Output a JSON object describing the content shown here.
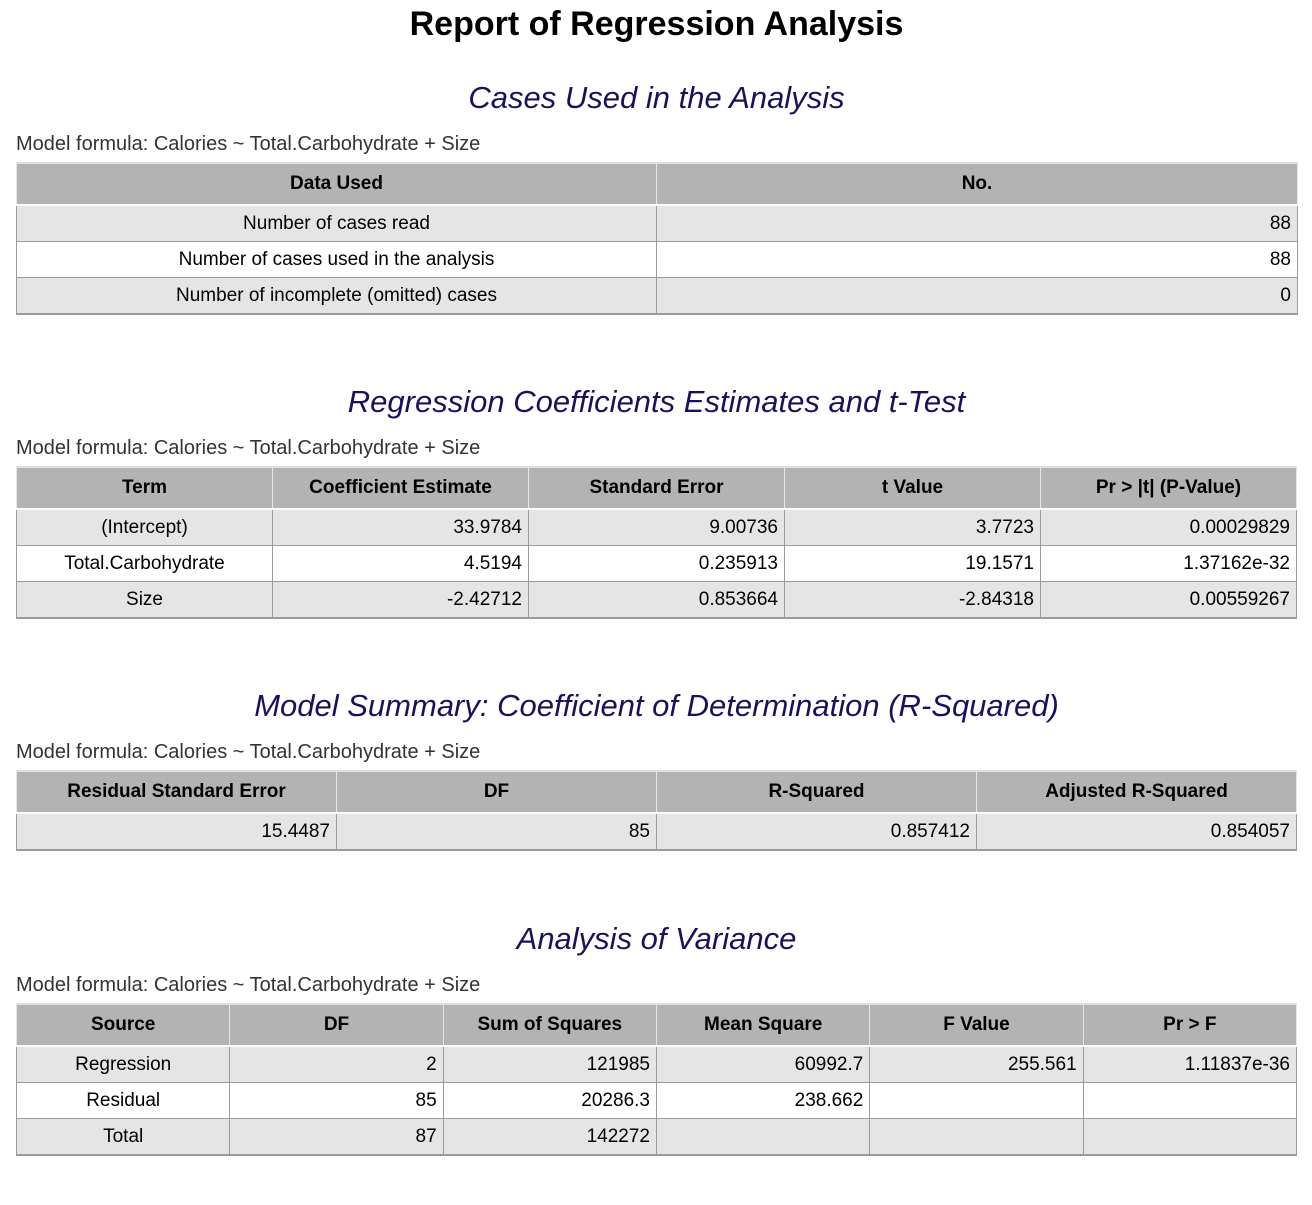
{
  "report_title": "Report of Regression Analysis",
  "sections": {
    "cases": {
      "title": "Cases Used in the Analysis",
      "formula": "Model formula: Calories ~ Total.Carbohydrate + Size",
      "headers": [
        "Data Used",
        "No."
      ],
      "rows": [
        [
          "Number of cases read",
          "88"
        ],
        [
          "Number of cases used in the analysis",
          "88"
        ],
        [
          "Number of incomplete (omitted) cases",
          "0"
        ]
      ]
    },
    "coef": {
      "title": "Regression Coefficients Estimates and t-Test",
      "formula": "Model formula: Calories ~ Total.Carbohydrate + Size",
      "headers": [
        "Term",
        "Coefficient Estimate",
        "Standard Error",
        "t Value",
        "Pr > |t| (P-Value)"
      ],
      "rows": [
        [
          "(Intercept)",
          "33.9784",
          "9.00736",
          "3.7723",
          "0.00029829"
        ],
        [
          "Total.Carbohydrate",
          "4.5194",
          "0.235913",
          "19.1571",
          "1.37162e-32"
        ],
        [
          "Size",
          "-2.42712",
          "0.853664",
          "-2.84318",
          "0.00559267"
        ]
      ]
    },
    "summary": {
      "title": "Model Summary: Coefficient of Determination (R-Squared)",
      "formula": "Model formula: Calories ~ Total.Carbohydrate + Size",
      "headers": [
        "Residual Standard Error",
        "DF",
        "R-Squared",
        "Adjusted R-Squared"
      ],
      "rows": [
        [
          "15.4487",
          "85",
          "0.857412",
          "0.854057"
        ]
      ]
    },
    "anova": {
      "title": "Analysis of Variance",
      "formula": "Model formula: Calories ~ Total.Carbohydrate + Size",
      "headers": [
        "Source",
        "DF",
        "Sum of Squares",
        "Mean Square",
        "F Value",
        "Pr > F"
      ],
      "rows": [
        [
          "Regression",
          "2",
          "121985",
          "60992.7",
          "255.561",
          "1.11837e-36"
        ],
        [
          "Residual",
          "85",
          "20286.3",
          "238.662",
          "",
          ""
        ],
        [
          "Total",
          "87",
          "142272",
          "",
          "",
          ""
        ]
      ]
    }
  }
}
